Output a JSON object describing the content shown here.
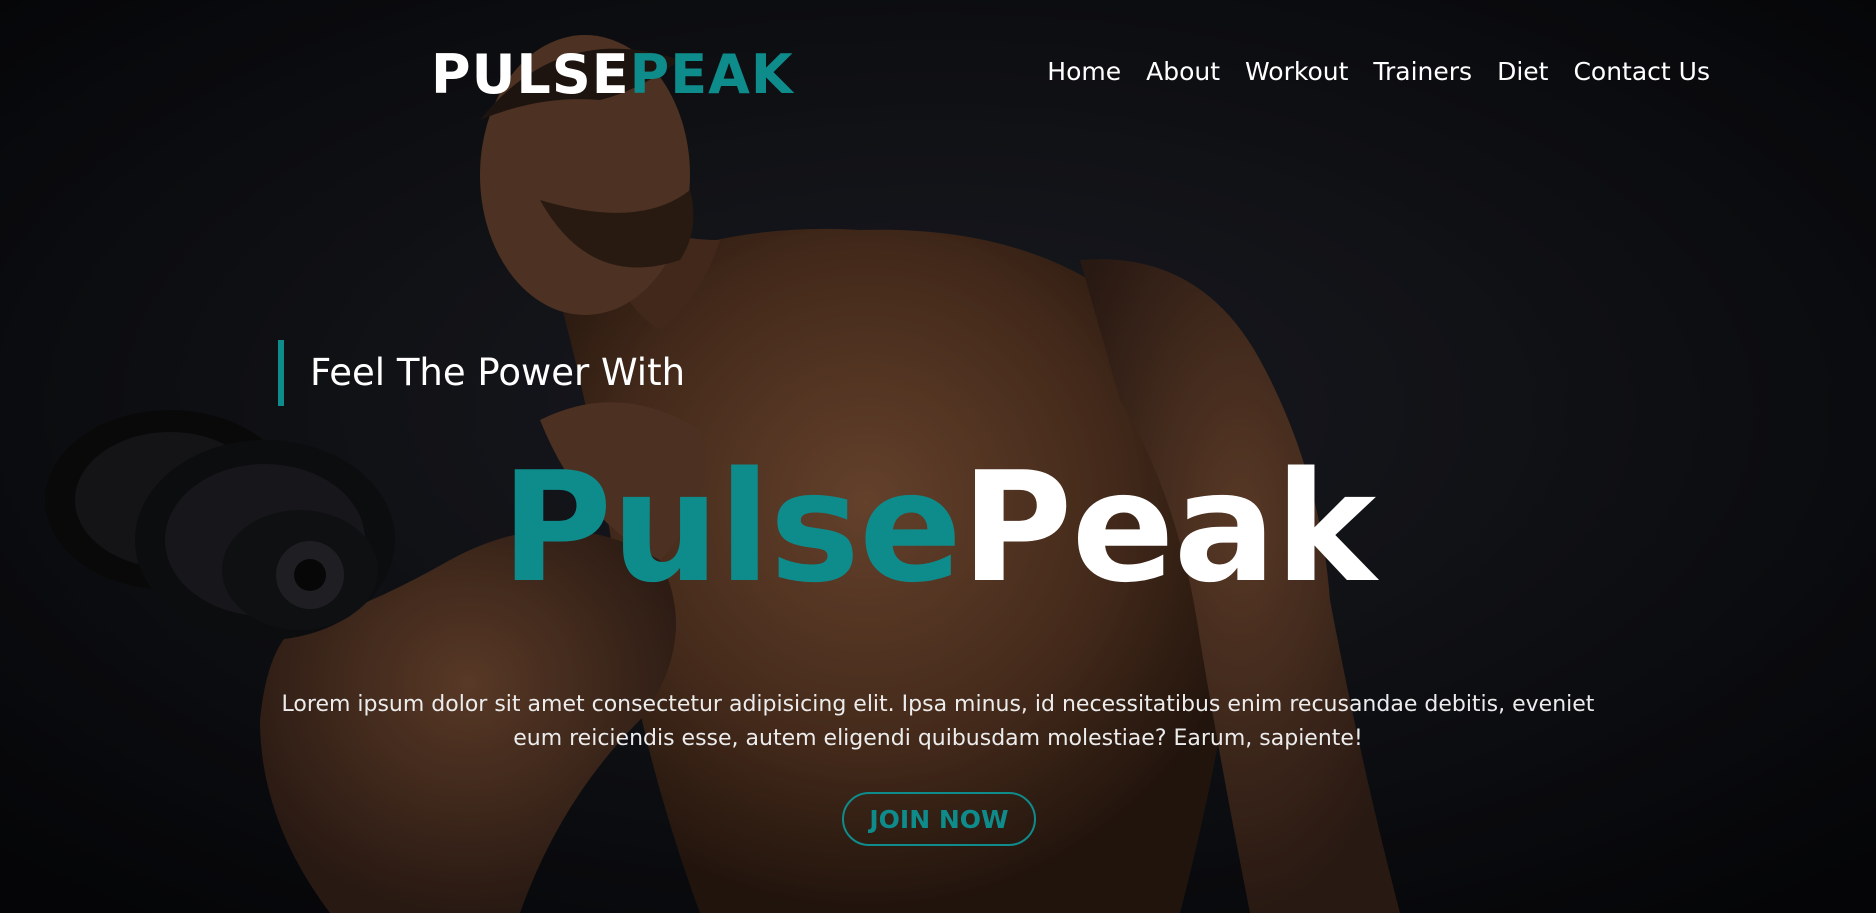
{
  "header": {
    "logo": {
      "part1": "PULSE",
      "part2": "PEAK"
    },
    "nav": [
      {
        "label": "Home"
      },
      {
        "label": "About"
      },
      {
        "label": "Workout"
      },
      {
        "label": "Trainers"
      },
      {
        "label": "Diet"
      },
      {
        "label": "Contact Us"
      }
    ]
  },
  "hero": {
    "tagline": "Feel The Power With",
    "brand": {
      "part1": "Pulse",
      "part2": "Peak"
    },
    "description": "Lorem ipsum dolor sit amet consectetur adipisicing elit. Ipsa minus, id necessitatibus enim recusandae debitis, eveniet eum reiciendis esse, autem eligendi quibusdam molestiae? Earum, sapiente!",
    "cta_label": "JOIN NOW"
  },
  "colors": {
    "accent": "#0e8c8c",
    "text": "#ffffff",
    "background": "#0b0c10"
  }
}
